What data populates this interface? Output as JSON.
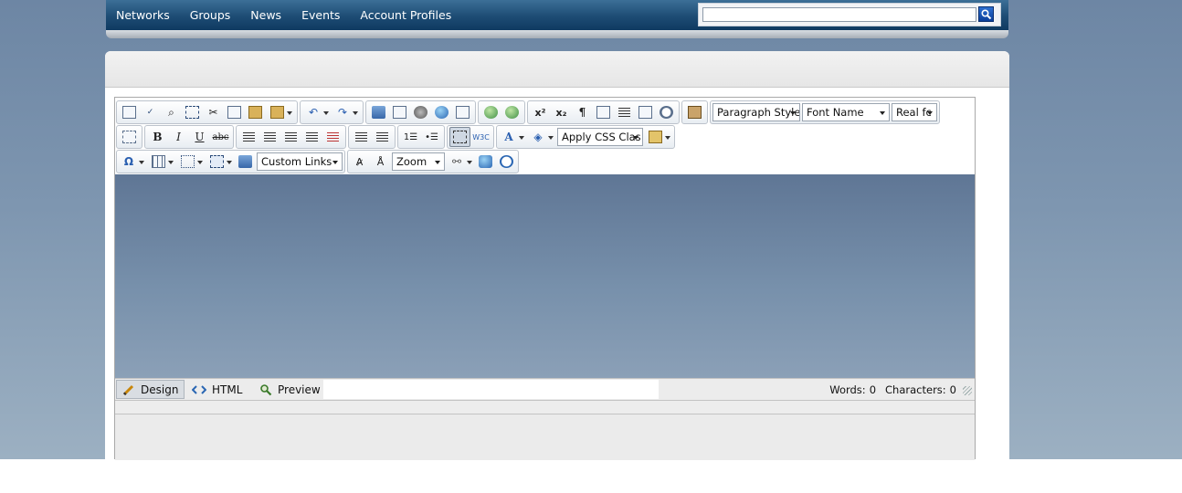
{
  "nav": {
    "links": [
      "Networks",
      "Groups",
      "News",
      "Events",
      "Account Profiles"
    ],
    "search": {
      "value": "",
      "placeholder": ""
    }
  },
  "editor": {
    "toolbar": {
      "paragraph_style": "Paragraph Style",
      "font_name": "Font Name",
      "font_size": "Real fc",
      "css_class": "Apply CSS Clas",
      "custom_links": "Custom Links",
      "zoom": "Zoom"
    },
    "modes": {
      "design": "Design",
      "html": "HTML",
      "preview": "Preview"
    },
    "counter": {
      "words_label": "Words:",
      "words": "0",
      "chars_label": "Characters:",
      "chars": "0"
    }
  },
  "colors": {
    "nav_bar": "#1d4c74",
    "page_background": "#7e96b0",
    "content_area": "#6f88a5"
  }
}
